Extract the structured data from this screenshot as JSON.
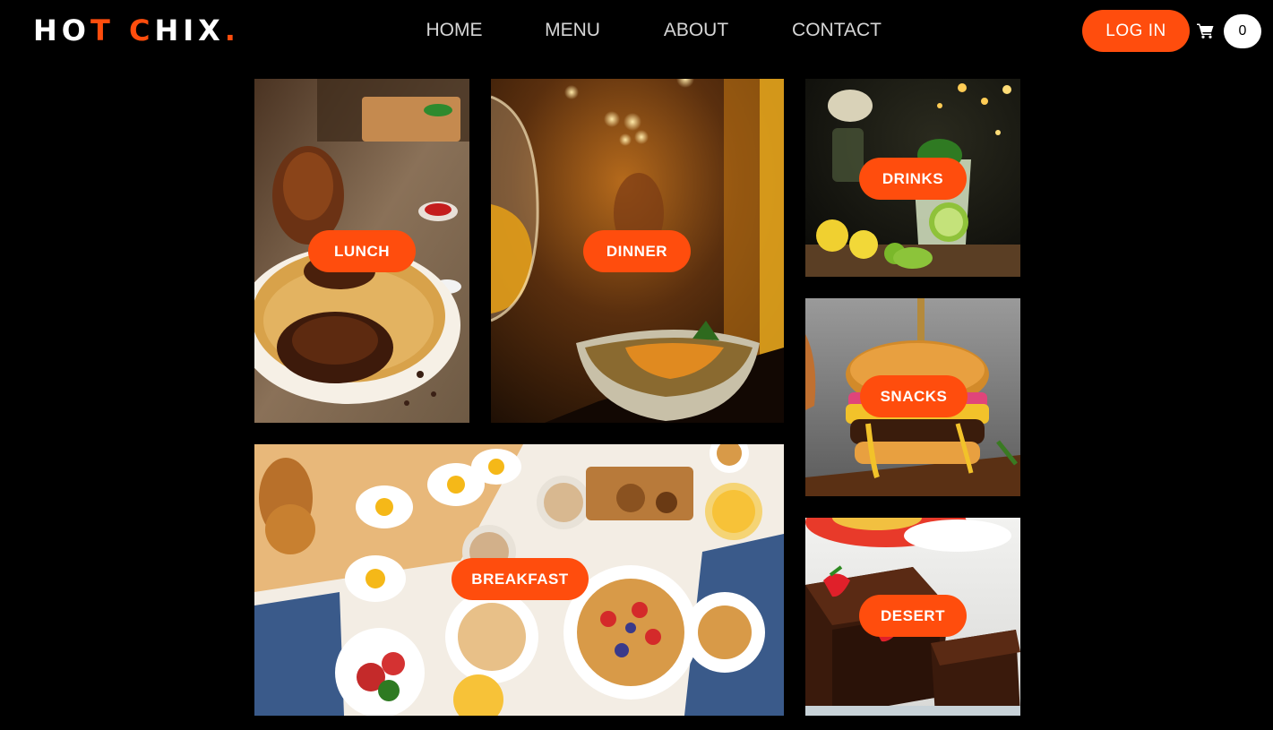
{
  "brand": {
    "part1": "HO",
    "part2": "T",
    "part3": " C",
    "part4": "HIX",
    "part5": "."
  },
  "nav": {
    "home": "HOME",
    "menu": "MENU",
    "about": "ABOUT",
    "contact": "CONTACT"
  },
  "auth": {
    "login_label": "LOG IN"
  },
  "cart": {
    "count": "0",
    "icon": "cart-icon"
  },
  "colors": {
    "accent": "#ff4d0d",
    "background": "#000000",
    "nav_text": "#d6d6d6"
  },
  "categories": [
    {
      "label": "LUNCH",
      "image": "biryani-chicken-plate"
    },
    {
      "label": "DINNER",
      "image": "wine-glass-restaurant-bowl"
    },
    {
      "label": "DRINKS",
      "image": "mojito-lemons"
    },
    {
      "label": "SNACKS",
      "image": "cheeseburger"
    },
    {
      "label": "BREAKFAST",
      "image": "waffles-eggs-tea-table"
    },
    {
      "label": "DESERT",
      "image": "chocolate-cake-strawberry"
    }
  ]
}
